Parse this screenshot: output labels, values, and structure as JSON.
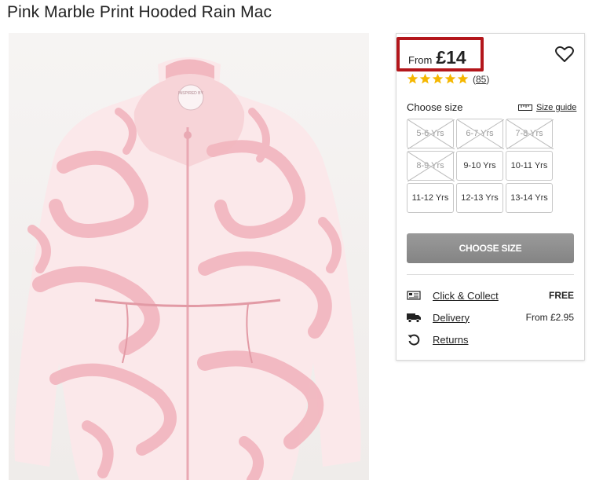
{
  "product": {
    "title": "Pink Marble Print Hooded Rain Mac",
    "image_alt": "Pink and white marble print hooded rain jacket",
    "jacket_brand_tag": "INSPIRED BY"
  },
  "pricing": {
    "from_label": "From",
    "price": "£14",
    "highlight_color": "#b3161b"
  },
  "rating": {
    "stars": 5,
    "max_stars": 5,
    "count": "85",
    "star_color": "#f5b700"
  },
  "sizes": {
    "label": "Choose size",
    "guide_label": "Size guide",
    "options": [
      {
        "label": "5-6 Yrs",
        "available": false
      },
      {
        "label": "6-7 Yrs",
        "available": false
      },
      {
        "label": "7-8 Yrs",
        "available": false
      },
      {
        "label": "8-9 Yrs",
        "available": false
      },
      {
        "label": "9-10 Yrs",
        "available": true
      },
      {
        "label": "10-11 Yrs",
        "available": true
      },
      {
        "label": "11-12 Yrs",
        "available": true
      },
      {
        "label": "12-13 Yrs",
        "available": true
      },
      {
        "label": "13-14 Yrs",
        "available": true
      }
    ]
  },
  "cta": {
    "label": "CHOOSE SIZE",
    "color": "#8a8a8a"
  },
  "services": [
    {
      "icon": "click-collect-icon",
      "label": "Click & Collect",
      "value": "FREE"
    },
    {
      "icon": "delivery-truck-icon",
      "label": "Delivery",
      "value": "From £2.95"
    },
    {
      "icon": "returns-icon",
      "label": "Returns",
      "value": ""
    }
  ]
}
